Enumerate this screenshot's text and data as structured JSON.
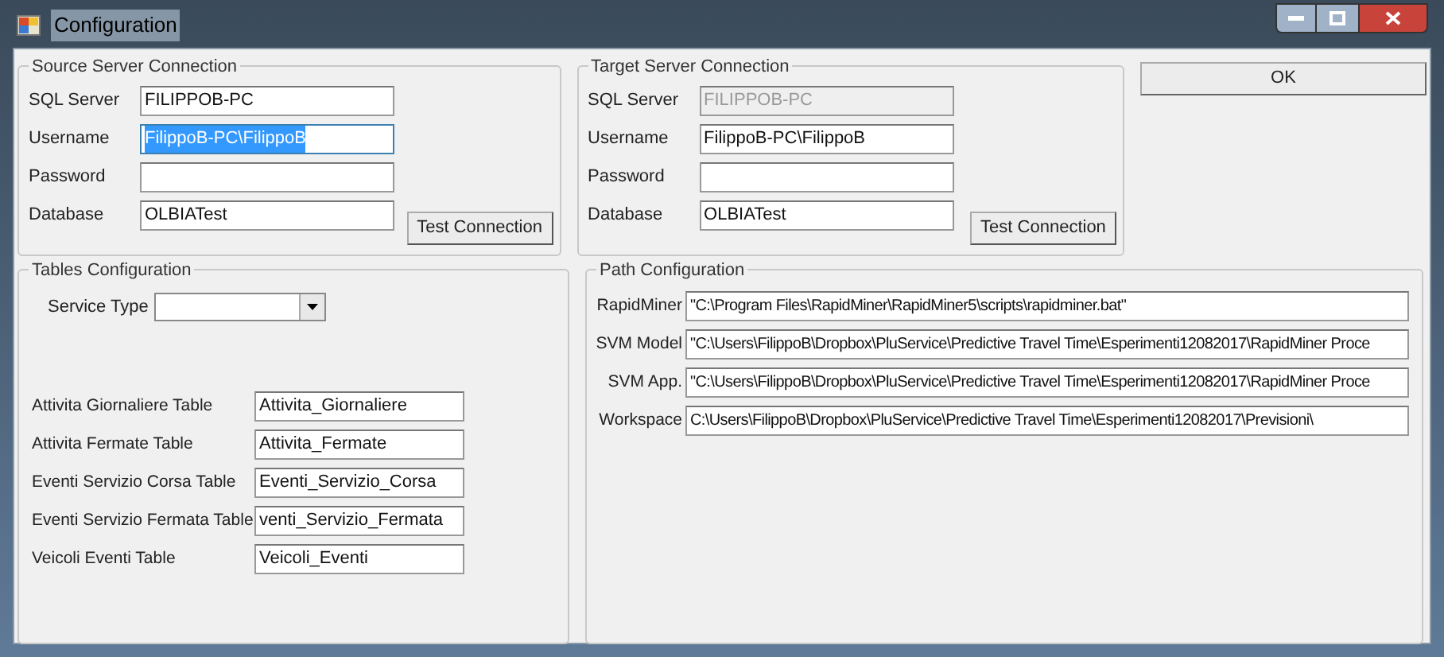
{
  "window": {
    "title": "Configuration"
  },
  "source": {
    "title": "Source Server Connection",
    "fields": [
      {
        "label": "SQL Server",
        "value": "FILIPPOB-PC",
        "selected": false,
        "disabled": false
      },
      {
        "label": "Username",
        "value": "FilippoB-PC\\FilippoB",
        "selected": true,
        "disabled": false
      },
      {
        "label": "Password",
        "selected": false,
        "disabled": false
      },
      {
        "label": "Database",
        "value": "OLBIATest",
        "selected": false,
        "disabled": false
      }
    ],
    "button": "Test Connection"
  },
  "target": {
    "title": "Target Server Connection",
    "fields": [
      {
        "label": "SQL Server",
        "value": "FILIPPOB-PC",
        "selected": false,
        "disabled": true
      },
      {
        "label": "Username",
        "value": "FilippoB-PC\\FilippoB",
        "selected": false,
        "disabled": false
      },
      {
        "label": "Password",
        "selected": false,
        "disabled": false
      },
      {
        "label": "Database",
        "value": "OLBIATest",
        "selected": false,
        "disabled": false
      }
    ],
    "button": "Test Connection"
  },
  "ok_button": "OK",
  "tables": {
    "title": "Tables Configuration",
    "service_type": {
      "label": "Service Type"
    },
    "fields": [
      {
        "label": "Attivita Giornaliere Table",
        "value": "Attivita_Giornaliere"
      },
      {
        "label": "Attivita Fermate Table",
        "value": "Attivita_Fermate"
      },
      {
        "label": "Eventi Servizio Corsa Table",
        "value": "Eventi_Servizio_Corsa"
      },
      {
        "label": "Eventi Servizio Fermata Table",
        "value": "venti_Servizio_Fermata"
      },
      {
        "label": "Veicoli Eventi Table",
        "value": "Veicoli_Eventi"
      }
    ]
  },
  "paths": {
    "title": "Path Configuration",
    "fields": [
      {
        "label": "RapidMiner",
        "value": "\"C:\\Program Files\\RapidMiner\\RapidMiner5\\scripts\\rapidminer.bat\""
      },
      {
        "label": "SVM Model",
        "value": "\"C:\\Users\\FilippoB\\Dropbox\\PluService\\Predictive Travel Time\\Esperimenti12082017\\RapidMiner Proce"
      },
      {
        "label": "SVM App.",
        "value": "\"C:\\Users\\FilippoB\\Dropbox\\PluService\\Predictive Travel Time\\Esperimenti12082017\\RapidMiner Proce"
      },
      {
        "label": "Workspace",
        "value": "C:\\Users\\FilippoB\\Dropbox\\PluService\\Predictive Travel Time\\Esperimenti12082017\\Previsioni\\"
      }
    ]
  }
}
